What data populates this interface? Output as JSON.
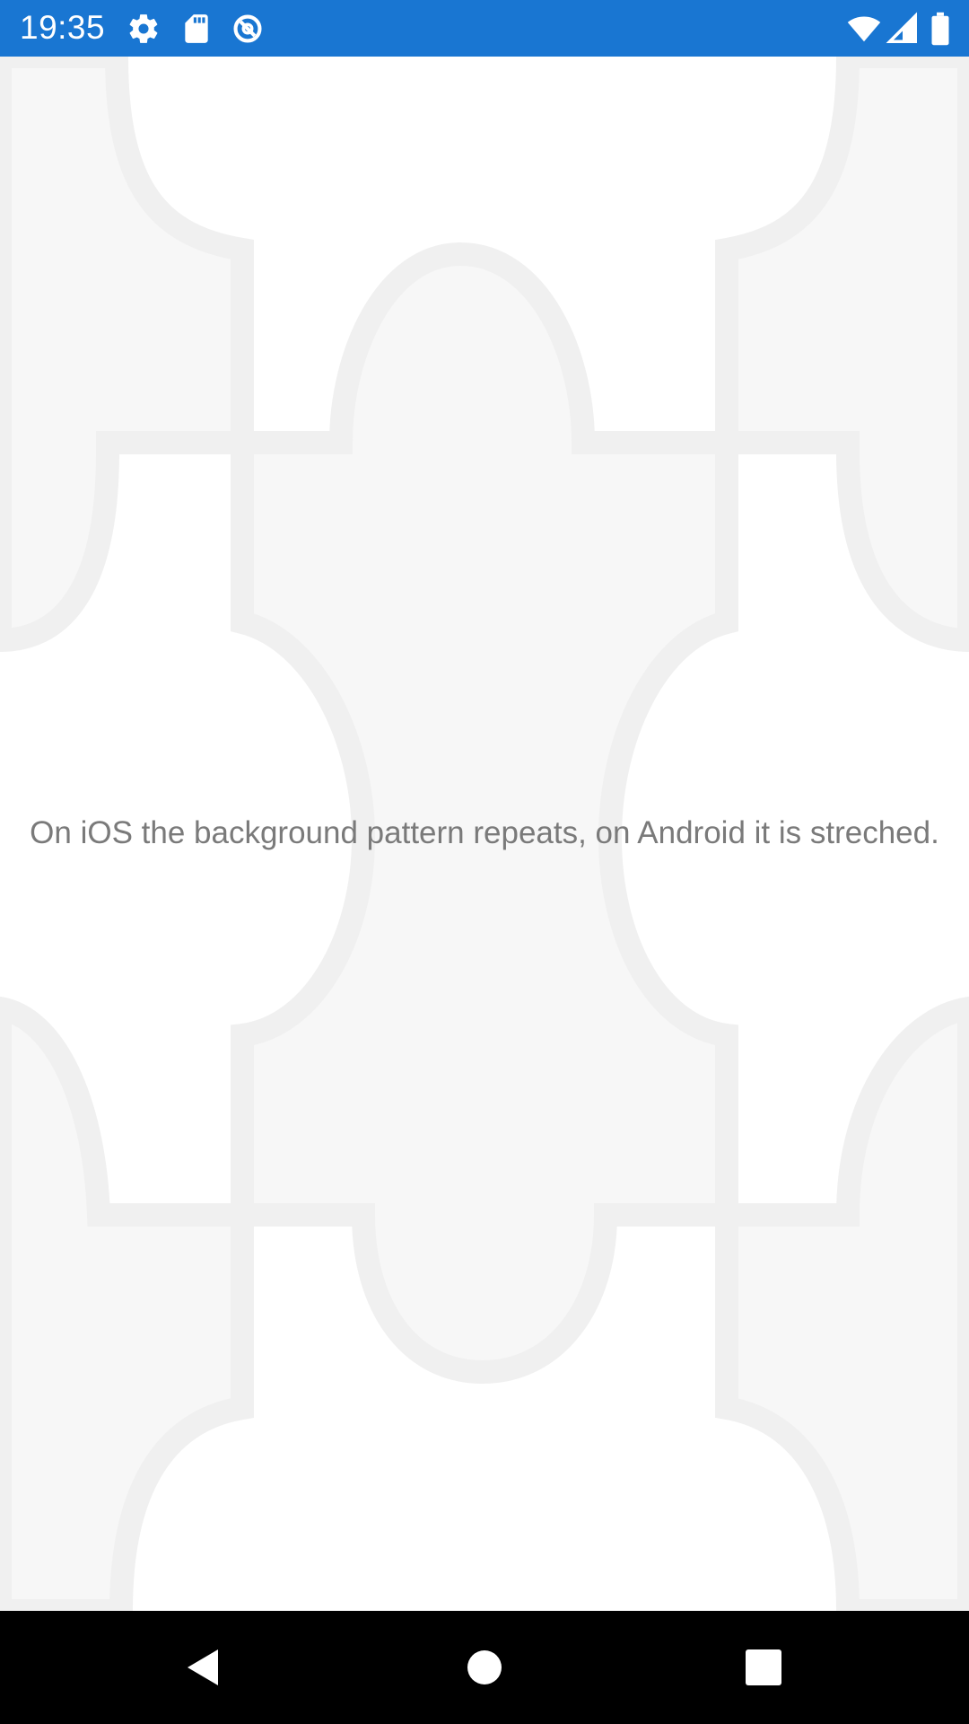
{
  "status_bar": {
    "time": "19:35",
    "color": "#1976D2",
    "left_icons": [
      "settings-icon",
      "sd-card-icon",
      "data-saver-icon"
    ],
    "right_icons": [
      "wifi-icon",
      "cellular-signal-icon",
      "battery-icon"
    ]
  },
  "main": {
    "message": "On iOS the background pattern repeats, on Android it is streched.",
    "text_color": "#7a7a7a",
    "background_pattern_colors": {
      "tile": "#f7f7f7",
      "outline": "#f0f0f0",
      "base": "#ffffff"
    }
  },
  "nav_bar": {
    "buttons": [
      "back-icon",
      "home-icon",
      "recents-icon"
    ],
    "color": "#000000"
  }
}
